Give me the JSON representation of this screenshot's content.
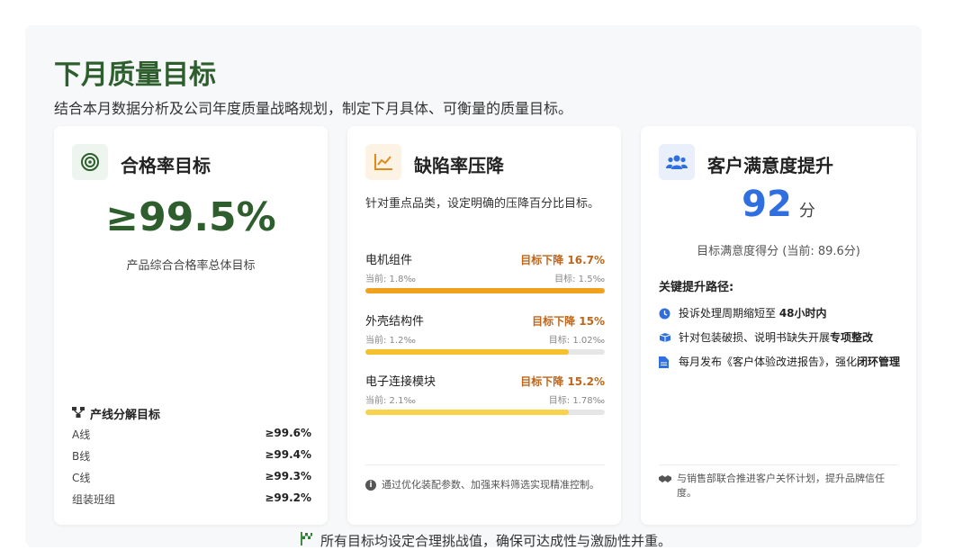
{
  "page": {
    "title": "下月质量目标",
    "subtitle": "结合本月数据分析及公司年度质量战略规划，制定下月具体、可衡量的质量目标。",
    "bottom_note": "所有目标均设定合理挑战值，确保可达成性与激励性并重。"
  },
  "card1": {
    "title": "合格率目标",
    "big_value": "≥99.5%",
    "big_desc": "产品综合合格率总体目标",
    "breakdown_title": "产线分解目标",
    "lines": [
      {
        "name": "A线",
        "value": "≥99.6%"
      },
      {
        "name": "B线",
        "value": "≥99.4%"
      },
      {
        "name": "C线",
        "value": "≥99.3%"
      },
      {
        "name": "组装班组",
        "value": "≥99.2%"
      }
    ],
    "icon": "target-icon",
    "accent": "#2e5e2e"
  },
  "card2": {
    "title": "缺陷率压降",
    "desc": "针对重点品类，设定明确的压降百分比目标。",
    "items": [
      {
        "name": "电机组件",
        "target": "目标下降 16.7%",
        "current": "当前: 1.8‰",
        "goal": "目标: 1.5‰",
        "progress": 1.0,
        "color": "#f0a21e"
      },
      {
        "name": "外壳结构件",
        "target": "目标下降 15%",
        "current": "当前: 1.2‰",
        "goal": "目标: 1.02‰",
        "progress": 0.85,
        "color": "#f5c02e"
      },
      {
        "name": "电子连接模块",
        "target": "目标下降 15.2%",
        "current": "当前: 2.1‰",
        "goal": "目标: 1.78‰",
        "progress": 0.85,
        "color": "#f8d24a"
      }
    ],
    "footnote": "通过优化装配参数、加强来料筛选实现精准控制。",
    "icon": "chart-line-icon",
    "accent": "#e08a1a"
  },
  "card3": {
    "title": "客户满意度提升",
    "score": "92",
    "score_unit": "分",
    "score_desc": "目标满意度得分 (当前: 89.6分)",
    "path_title": "关键提升路径:",
    "paths": [
      {
        "text": "投诉处理周期缩短至 ",
        "bold": "48小时内",
        "tail": "",
        "icon": "clock-icon"
      },
      {
        "text": "针对包装破损、说明书缺失开展",
        "bold": "专项整改",
        "tail": "",
        "icon": "boxes-icon"
      },
      {
        "text": "每月发布《客户体验改进报告》，强化",
        "bold": "闭环管理",
        "tail": "",
        "icon": "document-icon"
      }
    ],
    "footnote": "与销售部联合推进客户关怀计划，提升品牌信任度。",
    "icon": "users-icon",
    "accent": "#2f6fe0"
  }
}
